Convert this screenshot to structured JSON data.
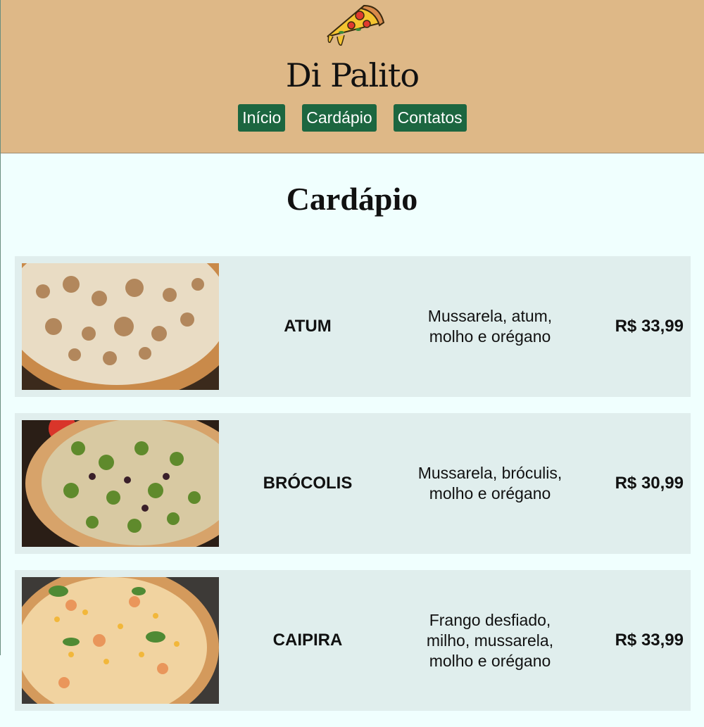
{
  "header": {
    "brand": "Di Palito",
    "nav": [
      "Início",
      "Cardápio",
      "Contatos"
    ],
    "logo_icon": "pizza-slice-icon",
    "background": "#deb887",
    "nav_color": "#1c6640"
  },
  "main": {
    "title": "Cardápio",
    "items": [
      {
        "name": "ATUM",
        "description": "Mussarela, atum, molho e orégano",
        "price": "R$ 33,99",
        "image_icon": "tuna-pizza-photo"
      },
      {
        "name": "BRÓCOLIS",
        "description": "Mussarela, bróculis, molho e orégano",
        "price": "R$ 30,99",
        "image_icon": "broccoli-pizza-photo"
      },
      {
        "name": "CAIPIRA",
        "description": "Frango desfiado, milho, mussarela, molho e orégano",
        "price": "R$ 33,99",
        "image_icon": "caipira-pizza-photo"
      }
    ]
  }
}
